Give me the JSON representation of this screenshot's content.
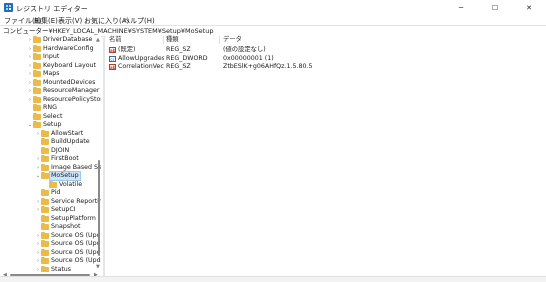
{
  "window": {
    "title": "レジストリ エディター",
    "minimize": "─",
    "maximize": "☐",
    "close": "✕"
  },
  "menu": [
    "ファイル(F)",
    "編集(E)",
    "表示(V)",
    "お気に入り(A)",
    "ヘルプ(H)"
  ],
  "address": "コンピューター¥HKEY_LOCAL_MACHINE¥SYSTEM¥Setup¥MoSetup",
  "tree": [
    {
      "label": "DriverDatabase",
      "depth": 0,
      "arrow": "›"
    },
    {
      "label": "HardwareConfig",
      "depth": 0,
      "arrow": "›"
    },
    {
      "label": "Input",
      "depth": 0,
      "arrow": "›"
    },
    {
      "label": "Keyboard Layout",
      "depth": 0,
      "arrow": "›"
    },
    {
      "label": "Maps",
      "depth": 0,
      "arrow": "›"
    },
    {
      "label": "MountedDevices",
      "depth": 0,
      "arrow": "›"
    },
    {
      "label": "ResourceManager",
      "depth": 0,
      "arrow": "›"
    },
    {
      "label": "ResourcePolicyStore",
      "depth": 0,
      "arrow": "›"
    },
    {
      "label": "RNG",
      "depth": 0,
      "arrow": ""
    },
    {
      "label": "Select",
      "depth": 0,
      "arrow": ""
    },
    {
      "label": "Setup",
      "depth": 0,
      "arrow": "⌄"
    },
    {
      "label": "AllowStart",
      "depth": 1,
      "arrow": "›"
    },
    {
      "label": "BuildUpdate",
      "depth": 1,
      "arrow": ""
    },
    {
      "label": "DJOIN",
      "depth": 1,
      "arrow": ""
    },
    {
      "label": "FirstBoot",
      "depth": 1,
      "arrow": "›"
    },
    {
      "label": "Image Based Setu",
      "depth": 1,
      "arrow": "›"
    },
    {
      "label": "MoSetup",
      "depth": 1,
      "arrow": "⌄",
      "selected": true
    },
    {
      "label": "Volatile",
      "depth": 2,
      "arrow": ""
    },
    {
      "label": "Pid",
      "depth": 1,
      "arrow": ""
    },
    {
      "label": "Service Reporting",
      "depth": 1,
      "arrow": "›"
    },
    {
      "label": "SetupCI",
      "depth": 1,
      "arrow": "›"
    },
    {
      "label": "SetupPlatform",
      "depth": 1,
      "arrow": ""
    },
    {
      "label": "Snapshot",
      "depth": 1,
      "arrow": ""
    },
    {
      "label": "Source OS (Updat",
      "depth": 1,
      "arrow": "›"
    },
    {
      "label": "Source OS (Updat",
      "depth": 1,
      "arrow": "›"
    },
    {
      "label": "Source OS (Updat",
      "depth": 1,
      "arrow": "›"
    },
    {
      "label": "Source OS (Updat",
      "depth": 1,
      "arrow": "›"
    },
    {
      "label": "Status",
      "depth": 1,
      "arrow": "›"
    }
  ],
  "columns": {
    "name": "名前",
    "type": "種類",
    "data": "データ"
  },
  "values": [
    {
      "icon": "string",
      "name": "(既定)",
      "type": "REG_SZ",
      "data": "(値の設定なし)"
    },
    {
      "icon": "dword",
      "name": "AllowUpgrades...",
      "type": "REG_DWORD",
      "data": "0x00000001 (1)"
    },
    {
      "icon": "string",
      "name": "CorrelationVector",
      "type": "REG_SZ",
      "data": "ZtbESlK+g06AHfQz.1.5.80.5"
    }
  ]
}
